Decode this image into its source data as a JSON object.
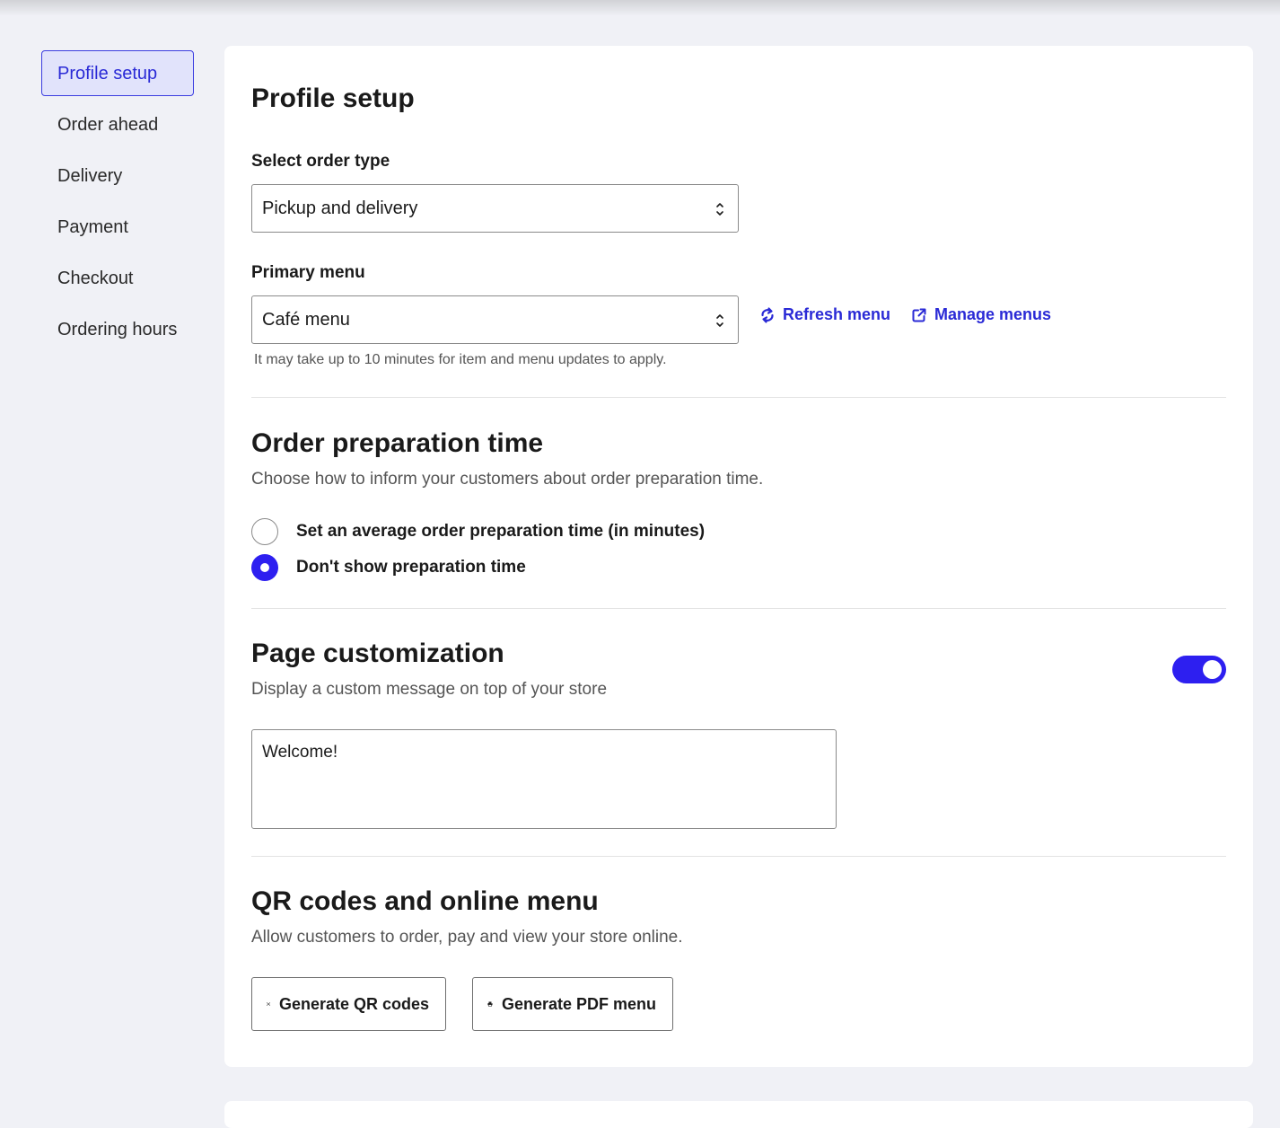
{
  "sidebar": {
    "items": [
      {
        "label": "Profile setup"
      },
      {
        "label": "Order ahead"
      },
      {
        "label": "Delivery"
      },
      {
        "label": "Payment"
      },
      {
        "label": "Checkout"
      },
      {
        "label": "Ordering hours"
      }
    ],
    "active_index": 0
  },
  "profile": {
    "title": "Profile setup",
    "order_type": {
      "label": "Select order type",
      "value": "Pickup and delivery"
    },
    "primary_menu": {
      "label": "Primary menu",
      "value": "Café menu",
      "refresh_label": "Refresh menu",
      "manage_label": "Manage menus",
      "hint": "It may take up to 10 minutes for item and menu updates to apply."
    }
  },
  "prep_time": {
    "title": "Order preparation time",
    "description": "Choose how to inform your customers about order preparation time.",
    "options": [
      {
        "label": "Set an average order preparation time (in minutes)",
        "checked": false
      },
      {
        "label": "Don't show preparation time",
        "checked": true
      }
    ]
  },
  "customization": {
    "title": "Page customization",
    "description": "Display a custom message on top of your store",
    "enabled": true,
    "message": "Welcome!"
  },
  "qr": {
    "title": "QR codes and online menu",
    "description": "Allow customers to order, pay and view your store online.",
    "qr_button": "Generate QR codes",
    "pdf_button": "Generate PDF menu"
  },
  "colors": {
    "accent": "#2d1ff0",
    "link": "#2a2ad6",
    "active_nav_bg": "#e1e3fb",
    "page_bg": "#f0f1f6"
  },
  "icons": {
    "select_chevron": "chevron-up-down-icon",
    "refresh": "refresh-icon",
    "external": "external-link-icon",
    "qr": "qr-code-icon",
    "print": "printer-icon"
  }
}
